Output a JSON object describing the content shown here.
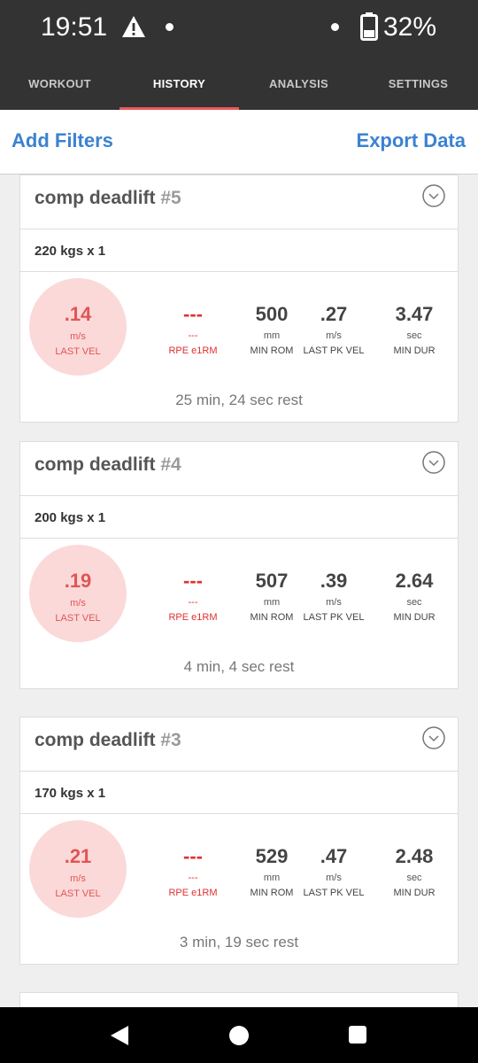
{
  "status": {
    "time": "19:51",
    "battery": "32%",
    "icons": [
      "warning-icon",
      "notification-dot-icon",
      "notification-dot-icon",
      "battery-icon"
    ]
  },
  "tabs": [
    {
      "label": "WORKOUT",
      "active": false
    },
    {
      "label": "HISTORY",
      "active": true
    },
    {
      "label": "ANALYSIS",
      "active": false
    },
    {
      "label": "SETTINGS",
      "active": false
    }
  ],
  "toolbar": {
    "add_filters": "Add Filters",
    "export_data": "Export Data"
  },
  "cards": [
    {
      "exercise": "comp deadlift",
      "number": "#5",
      "set": "220 kgs x 1",
      "last_vel": {
        "value": ".14",
        "unit": "m/s",
        "label": "LAST VEL"
      },
      "rpe": {
        "value": "---",
        "unit": "---",
        "label": "RPE e1RM"
      },
      "min_rom": {
        "value": "500",
        "unit": "mm",
        "label": "MIN ROM"
      },
      "last_pk_vel": {
        "value": ".27",
        "unit": "m/s",
        "label": "LAST PK VEL"
      },
      "min_dur": {
        "value": "3.47",
        "unit": "sec",
        "label": "MIN DUR"
      },
      "rest": "25 min, 24 sec rest"
    },
    {
      "exercise": "comp deadlift",
      "number": "#4",
      "set": "200 kgs x 1",
      "last_vel": {
        "value": ".19",
        "unit": "m/s",
        "label": "LAST VEL"
      },
      "rpe": {
        "value": "---",
        "unit": "---",
        "label": "RPE e1RM"
      },
      "min_rom": {
        "value": "507",
        "unit": "mm",
        "label": "MIN ROM"
      },
      "last_pk_vel": {
        "value": ".39",
        "unit": "m/s",
        "label": "LAST PK VEL"
      },
      "min_dur": {
        "value": "2.64",
        "unit": "sec",
        "label": "MIN DUR"
      },
      "rest": "4 min, 4 sec rest"
    },
    {
      "exercise": "comp deadlift",
      "number": "#3",
      "set": "170 kgs x 1",
      "last_vel": {
        "value": ".21",
        "unit": "m/s",
        "label": "LAST VEL"
      },
      "rpe": {
        "value": "---",
        "unit": "---",
        "label": "RPE e1RM"
      },
      "min_rom": {
        "value": "529",
        "unit": "mm",
        "label": "MIN ROM"
      },
      "last_pk_vel": {
        "value": ".47",
        "unit": "m/s",
        "label": "LAST PK VEL"
      },
      "min_dur": {
        "value": "2.48",
        "unit": "sec",
        "label": "MIN DUR"
      },
      "rest": "3 min, 19 sec rest"
    }
  ],
  "colors": {
    "header_bg": "#333333",
    "accent_blue": "#3b82d1",
    "accent_red": "#e03030",
    "tab_indicator": "#e85a5a",
    "velocity_circle": "#fbd9d9"
  },
  "nav": {
    "icons": [
      "back-icon",
      "home-icon",
      "recents-icon"
    ]
  }
}
